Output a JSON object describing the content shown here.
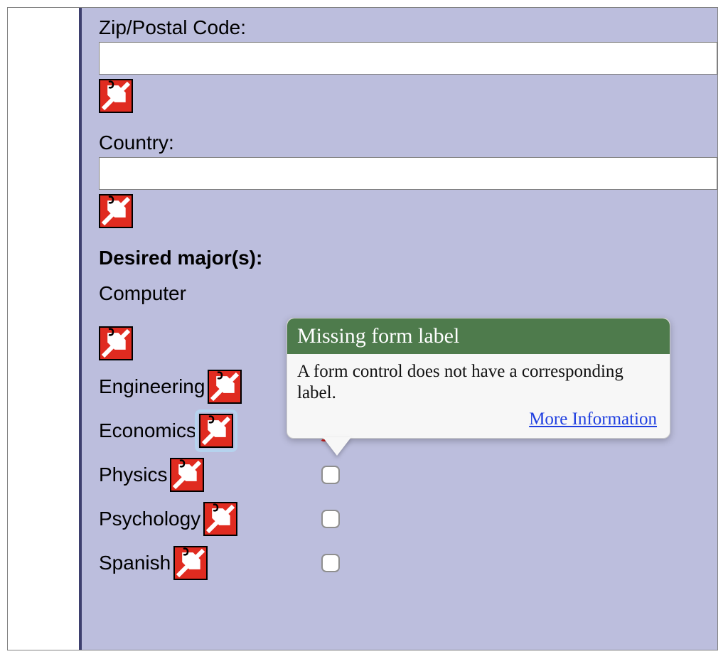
{
  "fields": {
    "zip": {
      "label": "Zip/Postal Code:",
      "value": ""
    },
    "country": {
      "label": "Country:",
      "value": ""
    }
  },
  "section_heading": "Desired major(s):",
  "majors": [
    {
      "label": "Computer",
      "checkbox_visible": false,
      "flagged": false
    },
    {
      "label": "Engineering",
      "checkbox_visible": false,
      "flagged": false
    },
    {
      "label": "Economics",
      "checkbox_visible": true,
      "flagged": true
    },
    {
      "label": "Physics",
      "checkbox_visible": true,
      "flagged": false
    },
    {
      "label": "Psychology",
      "checkbox_visible": true,
      "flagged": false
    },
    {
      "label": "Spanish",
      "checkbox_visible": true,
      "flagged": false
    }
  ],
  "tooltip": {
    "title": "Missing form label",
    "body": "A form control does not have a corresponding label.",
    "link_text": "More Information"
  },
  "icons": {
    "error_tag": "missing-label-icon"
  },
  "colors": {
    "panel_bg": "#bcbedd",
    "panel_border": "#3d3f6e",
    "tooltip_header": "#4e7b4c",
    "error_icon": "#e02b20",
    "link": "#1f3fe0"
  }
}
